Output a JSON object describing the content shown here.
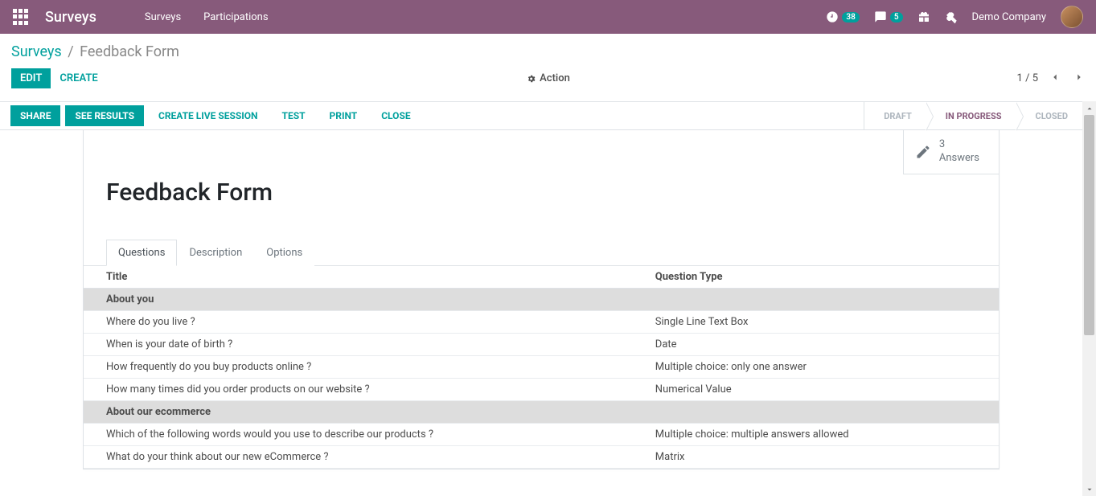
{
  "nav": {
    "brand": "Surveys",
    "menu": [
      "Surveys",
      "Participations"
    ],
    "timer_badge": "38",
    "chat_badge": "5",
    "company": "Demo Company"
  },
  "breadcrumb": {
    "parent": "Surveys",
    "current": "Feedback Form"
  },
  "buttons": {
    "edit": "EDIT",
    "create": "CREATE"
  },
  "action": "Action",
  "pager": {
    "pos": "1",
    "sep": "/",
    "total": "5"
  },
  "toolbar": {
    "share": "SHARE",
    "results": "SEE RESULTS",
    "live": "CREATE LIVE SESSION",
    "test": "TEST",
    "print": "PRINT",
    "close": "CLOSE"
  },
  "statuses": {
    "draft": "DRAFT",
    "progress": "IN PROGRESS",
    "closed": "CLOSED"
  },
  "stat": {
    "count": "3",
    "label": "Answers"
  },
  "title": "Feedback Form",
  "tabs": {
    "q": "Questions",
    "d": "Description",
    "o": "Options"
  },
  "table": {
    "h1": "Title",
    "h2": "Question Type",
    "rows": [
      {
        "type": "section",
        "title": "About you",
        "qtype": ""
      },
      {
        "type": "row",
        "title": "Where do you live ?",
        "qtype": "Single Line Text Box"
      },
      {
        "type": "row",
        "title": "When is your date of birth ?",
        "qtype": "Date"
      },
      {
        "type": "row",
        "title": "How frequently do you buy products online ?",
        "qtype": "Multiple choice: only one answer"
      },
      {
        "type": "row",
        "title": "How many times did you order products on our website ?",
        "qtype": "Numerical Value"
      },
      {
        "type": "section",
        "title": "About our ecommerce",
        "qtype": ""
      },
      {
        "type": "row",
        "title": "Which of the following words would you use to describe our products ?",
        "qtype": "Multiple choice: multiple answers allowed"
      },
      {
        "type": "row",
        "title": "What do your think about our new eCommerce ?",
        "qtype": "Matrix"
      }
    ]
  }
}
